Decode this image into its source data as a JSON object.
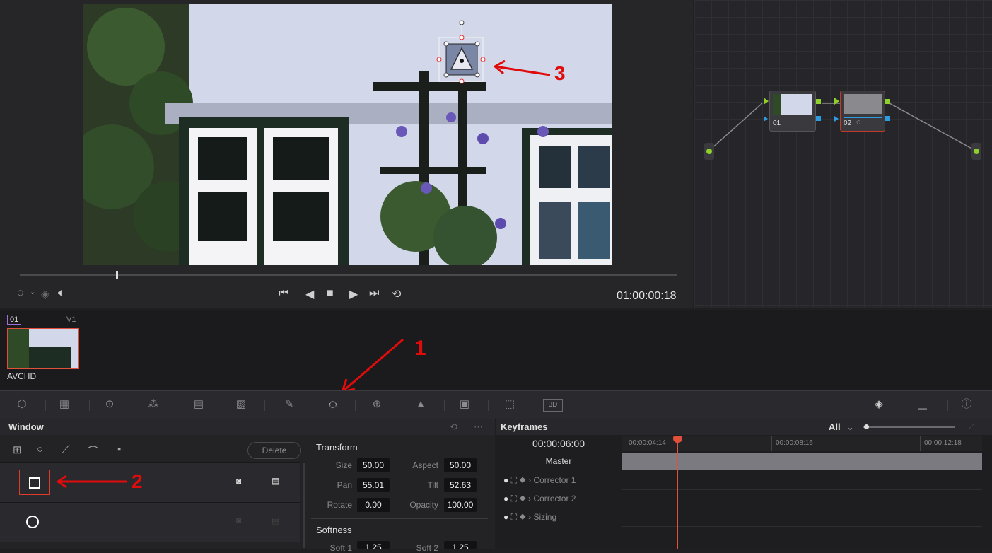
{
  "viewer": {
    "timecode": "01:00:00:18",
    "annotation_marker": "3"
  },
  "node_graph": {
    "nodes": [
      {
        "label": "01"
      },
      {
        "label": "02"
      }
    ]
  },
  "clip_strip": {
    "clip_number": "01",
    "track": "V1",
    "clip_name": "AVCHD"
  },
  "toolbar": {
    "annotation_marker": "1",
    "right_badge": "3D"
  },
  "window_panel": {
    "title": "Window",
    "delete_label": "Delete",
    "annotation_marker": "2",
    "transform": {
      "heading": "Transform",
      "size_label": "Size",
      "size_value": "50.00",
      "aspect_label": "Aspect",
      "aspect_value": "50.00",
      "pan_label": "Pan",
      "pan_value": "55.01",
      "tilt_label": "Tilt",
      "tilt_value": "52.63",
      "rotate_label": "Rotate",
      "rotate_value": "0.00",
      "opacity_label": "Opacity",
      "opacity_value": "100.00"
    },
    "softness": {
      "heading": "Softness",
      "soft1_label": "Soft 1",
      "soft1_value": "1.25",
      "soft2_label": "Soft 2",
      "soft2_value": "1.25"
    }
  },
  "keyframes": {
    "title": "Keyframes",
    "filter": "All",
    "current_time": "00:00:06:00",
    "ruler": [
      "00:00:04:14",
      "00:00:08:16",
      "00:00:12:18"
    ],
    "rows": [
      "Master",
      "Corrector 1",
      "Corrector 2",
      "Sizing"
    ]
  },
  "colors": {
    "annotation": "#e00b0b",
    "playhead": "#e0503a",
    "node_input": "#8fd12a",
    "node_output": "#2f9be0"
  }
}
